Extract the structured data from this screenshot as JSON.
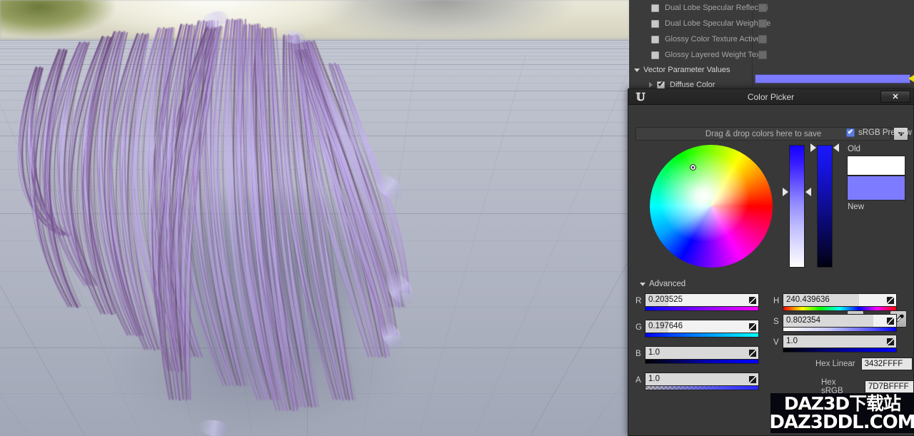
{
  "details_panel": {
    "rows": [
      {
        "label": "Dual Lobe Specular Reflectivi",
        "checked": false
      },
      {
        "label": "Dual Lobe Specular Weight Te",
        "checked": false
      },
      {
        "label": "Glossy Color Texture Active",
        "checked": false
      },
      {
        "label": "Glossy Layered Weight Textu",
        "checked": false
      }
    ],
    "category": "Vector Parameter Values",
    "diffuse": {
      "label": "Diffuse Color",
      "checked": true,
      "check_glyph": "✔",
      "swatch_color": "#7d7bff"
    }
  },
  "picker": {
    "title": "Color Picker",
    "logo": "ue-logo",
    "close_label": "✕",
    "saved_colors_placeholder": "Drag & drop colors here to save",
    "dropdown_icon": "chevron-down-icon",
    "srgb_preview_label": "sRGB Preview",
    "srgb_preview_checked": true,
    "srgb_check_glyph": "✔",
    "old_label": "Old",
    "new_label": "New",
    "old_color": "#ffffff",
    "new_color": "#7d7bff",
    "wheel_icon": "color-wheel-icon",
    "eyedropper_icon": "eyedropper-icon",
    "advanced_label": "Advanced",
    "rgba": [
      {
        "key": "R",
        "label": "R",
        "value": "0.203525",
        "fill_pct": 20
      },
      {
        "key": "G",
        "label": "G",
        "value": "0.197646",
        "fill_pct": 20
      },
      {
        "key": "B",
        "label": "B",
        "value": "1.0",
        "fill_pct": 100
      },
      {
        "key": "A",
        "label": "A",
        "value": "1.0",
        "fill_pct": 100
      }
    ],
    "hsv": [
      {
        "key": "H",
        "label": "H",
        "value": "240.439636",
        "fill_pct": 67
      },
      {
        "key": "S",
        "label": "S",
        "value": "0.802354",
        "fill_pct": 80
      },
      {
        "key": "V",
        "label": "V",
        "value": "1.0",
        "fill_pct": 100
      }
    ],
    "hex_linear_label": "Hex Linear",
    "hex_linear_value": "3432FFFF",
    "hex_srgb_label": "Hex sRGB",
    "hex_srgb_value": "7D7BFFFF"
  },
  "watermark": {
    "line1": "DAZ3D下载站",
    "line2": "DAZ3DDL.COM"
  }
}
